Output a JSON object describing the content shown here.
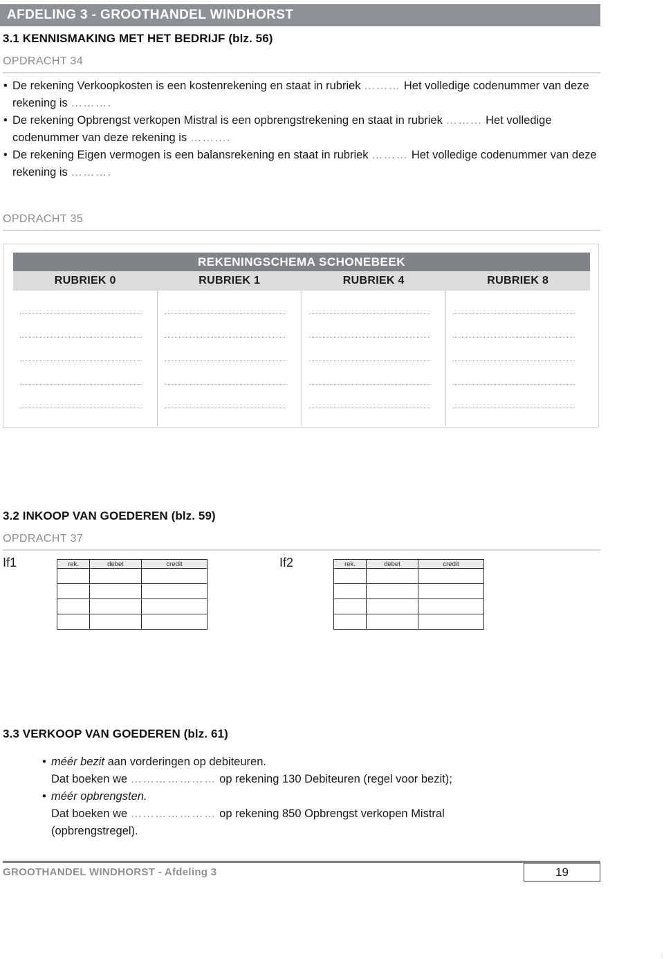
{
  "chapter": {
    "banner_title": "AFDELING 3 - GROOTHANDEL WINDHORST"
  },
  "sections": {
    "s31": {
      "heading": "3.1 KENNISMAKING MET HET BEDRIJF (blz. 56)",
      "opdracht": "OPDRACHT 34",
      "bullets": [
        {
          "bullet": "•",
          "part1": "De rekening Verkoopkosten is een kostenrekening en staat in rubriek",
          "dots1": "………",
          "part2": "Het volledige codenummer van deze rekening is",
          "dots2": "………."
        },
        {
          "bullet": "•",
          "part1": "De rekening Opbrengst verkopen Mistral is een opbrengstrekening en staat in rubriek",
          "dots1": "………",
          "part2": "Het volledige codenummer van deze rekening is",
          "dots2": "………."
        },
        {
          "bullet": "•",
          "part1": "De rekening Eigen vermogen is een balansrekening en staat in rubriek",
          "dots1": "………",
          "part2": "Het volledige codenummer van deze rekening is",
          "dots2": "………."
        }
      ]
    },
    "s32": {
      "heading": "3.2 INKOOP VAN GOEDEREN (blz. 59)",
      "opdracht": "OPDRACHT 37",
      "journals": [
        {
          "label": "If1",
          "columns": [
            "rek.",
            "debet",
            "credit"
          ],
          "rows": [
            [
              "",
              "",
              ""
            ],
            [
              "",
              "",
              ""
            ],
            [
              "",
              "",
              ""
            ],
            [
              "",
              "",
              ""
            ]
          ]
        },
        {
          "label": "If2",
          "columns": [
            "rek.",
            "debet",
            "credit"
          ],
          "rows": [
            [
              "",
              "",
              ""
            ],
            [
              "",
              "",
              ""
            ],
            [
              "",
              "",
              ""
            ],
            [
              "",
              "",
              ""
            ]
          ]
        }
      ]
    },
    "s33": {
      "heading": "3.3 VERKOOP VAN GOEDEREN (blz. 61)",
      "bullets": [
        {
          "bullet": "•",
          "em": "méér bezit",
          "rest": " aan vorderingen op debiteuren.",
          "line2_pre": "Dat boeken we",
          "line2_dots": "…………………",
          "line2_post": "op rekening 130 Debiteuren (regel voor bezit);"
        },
        {
          "bullet": "•",
          "em": "méér opbrengsten.",
          "rest": "",
          "line2_pre": "Dat boeken we",
          "line2_dots": "…………………",
          "line2_post": "op rekening 850 Opbrengst verkopen Mistral",
          "line3": "(opbrengstregel)."
        }
      ]
    }
  },
  "opdracht35": {
    "opdracht": "OPDRACHT 35",
    "table": {
      "title": "REKENINGSCHEMA SCHONEBEEK",
      "columns": [
        "RUBRIEK 0",
        "RUBRIEK 1",
        "RUBRIEK 4",
        "RUBRIEK 8"
      ],
      "blank_rows": 5
    }
  },
  "footer": {
    "text": "GROOTHANDEL WINDHORST - Afdeling 3",
    "page_number": "19"
  },
  "colors": {
    "banner_gray": "#8d9094",
    "table_header_gray": "#808387",
    "table_subhead_gray": "#dbdcdd",
    "rule_gray": "#d7d7d7",
    "muted_text": "#8c8c8c"
  }
}
